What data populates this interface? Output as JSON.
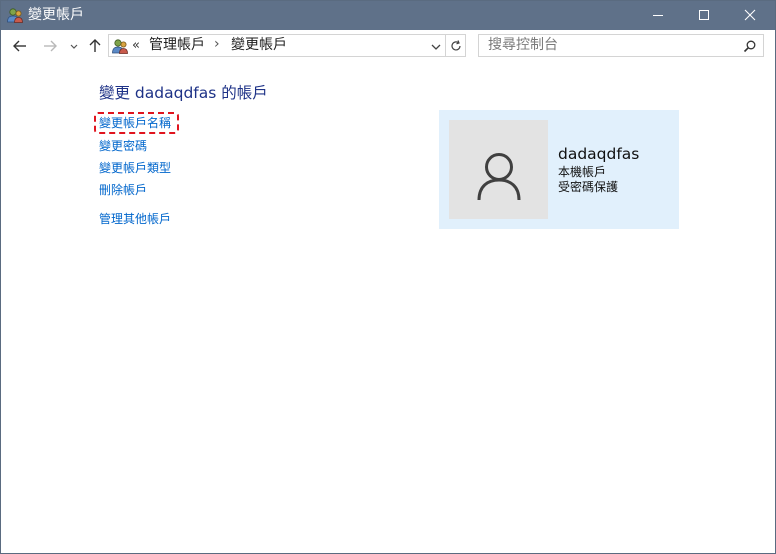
{
  "window": {
    "title": "變更帳戶"
  },
  "address_bar": {
    "overflow_chevron": "«",
    "breadcrumbs": [
      "管理帳戶",
      "變更帳戶"
    ],
    "separator": "›"
  },
  "search": {
    "placeholder": "搜尋控制台"
  },
  "main": {
    "title": "變更 dadaqdfas 的帳戶",
    "tasks": [
      {
        "label": "變更帳戶名稱",
        "focused": true
      },
      {
        "label": "變更密碼"
      },
      {
        "label": "變更帳戶類型"
      },
      {
        "label": "刪除帳戶"
      },
      {
        "label": "管理其他帳戶"
      }
    ]
  },
  "account": {
    "name": "dadaqdfas",
    "type": "本機帳戶",
    "protection": "受密碼保護"
  },
  "colors": {
    "titlebar": "#5f7189",
    "link": "#0066cc",
    "title_text": "#1e3287",
    "card_bg": "#e1f0fc",
    "focus_ring": "#e0141e"
  }
}
